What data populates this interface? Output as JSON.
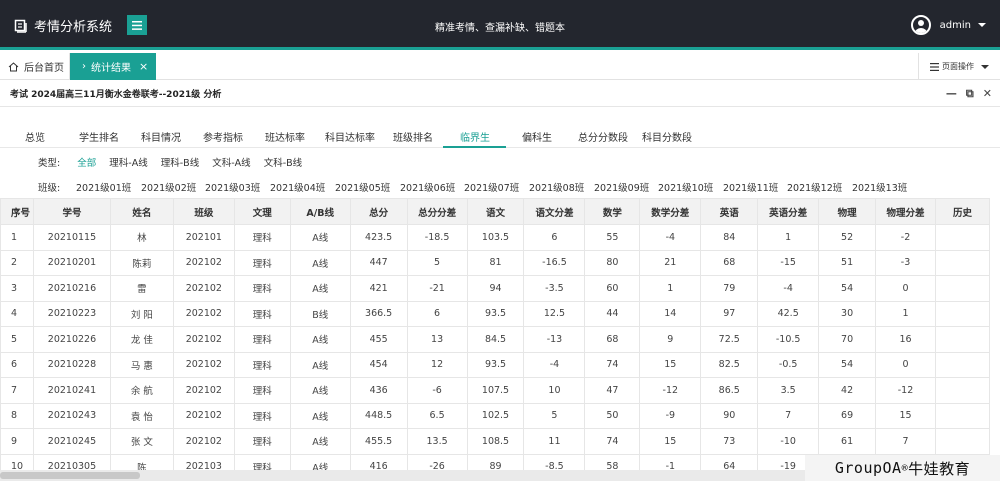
{
  "header": {
    "app_title": "考情分析系统",
    "slogan": "精准考情、查漏补缺、错题本",
    "username": "admin"
  },
  "tabs": {
    "home_label": "后台首页",
    "active_label": "统计结果",
    "page_ops_label": "页面操作"
  },
  "panel": {
    "title": "考试 2024届高三11月衡水金卷联考--2021级 分析"
  },
  "subtabs": [
    {
      "label": "总览"
    },
    {
      "label": "学生排名"
    },
    {
      "label": "科目情况"
    },
    {
      "label": "参考指标"
    },
    {
      "label": "班达标率"
    },
    {
      "label": "科目达标率"
    },
    {
      "label": "班级排名"
    },
    {
      "label": "临界生",
      "active": true
    },
    {
      "label": "偏科生"
    },
    {
      "label": "总分分数段"
    },
    {
      "label": "科目分数段"
    }
  ],
  "filters": {
    "type_label": "类型:",
    "type_options": [
      "全部",
      "理科-A线",
      "理科-B线",
      "文科-A线",
      "文科-B线"
    ],
    "type_selected": "全部",
    "class_label": "班级:",
    "class_options": [
      "2021级01班",
      "2021级02班",
      "2021级03班",
      "2021级04班",
      "2021级05班",
      "2021级06班",
      "2021级07班",
      "2021级08班",
      "2021级09班",
      "2021级10班",
      "2021级11班",
      "2021级12班",
      "2021级13班"
    ]
  },
  "table": {
    "columns": [
      "序号",
      "学号",
      "姓名",
      "班级",
      "文理",
      "A/B线",
      "总分",
      "总分分差",
      "语文",
      "语文分差",
      "数学",
      "数学分差",
      "英语",
      "英语分差",
      "物理",
      "物理分差",
      "历史"
    ],
    "rows": [
      [
        "1",
        "20210115",
        "林 ",
        "202101",
        "理科",
        "A线",
        "423.5",
        "-18.5",
        "103.5",
        "6",
        "55",
        "-4",
        "84",
        "1",
        "52",
        "-2",
        ""
      ],
      [
        "2",
        "20210201",
        "陈莉 ",
        "202102",
        "理科",
        "A线",
        "447",
        "5",
        "81",
        "-16.5",
        "80",
        "21",
        "68",
        "-15",
        "51",
        "-3",
        ""
      ],
      [
        "3",
        "20210216",
        "雷 ",
        "202102",
        "理科",
        "A线",
        "421",
        "-21",
        "94",
        "-3.5",
        "60",
        "1",
        "79",
        "-4",
        "54",
        "0",
        ""
      ],
      [
        "4",
        "20210223",
        "刘 阳",
        "202102",
        "理科",
        "B线",
        "366.5",
        "6",
        "93.5",
        "12.5",
        "44",
        "14",
        "97",
        "42.5",
        "30",
        "1",
        ""
      ],
      [
        "5",
        "20210226",
        "龙 佳",
        "202102",
        "理科",
        "A线",
        "455",
        "13",
        "84.5",
        "-13",
        "68",
        "9",
        "72.5",
        "-10.5",
        "70",
        "16",
        ""
      ],
      [
        "6",
        "20210228",
        "马 惠",
        "202102",
        "理科",
        "A线",
        "454",
        "12",
        "93.5",
        "-4",
        "74",
        "15",
        "82.5",
        "-0.5",
        "54",
        "0",
        ""
      ],
      [
        "7",
        "20210241",
        "余 航",
        "202102",
        "理科",
        "A线",
        "436",
        "-6",
        "107.5",
        "10",
        "47",
        "-12",
        "86.5",
        "3.5",
        "42",
        "-12",
        ""
      ],
      [
        "8",
        "20210243",
        "袁 怡",
        "202102",
        "理科",
        "A线",
        "448.5",
        "6.5",
        "102.5",
        "5",
        "50",
        "-9",
        "90",
        "7",
        "69",
        "15",
        ""
      ],
      [
        "9",
        "20210245",
        "张 文",
        "202102",
        "理科",
        "A线",
        "455.5",
        "13.5",
        "108.5",
        "11",
        "74",
        "15",
        "73",
        "-10",
        "61",
        "7",
        ""
      ],
      [
        "10",
        "20210305",
        "陈 ",
        "202103",
        "理科",
        "A线",
        "416",
        "-26",
        "89",
        "-8.5",
        "58",
        "-1",
        "64",
        "-19",
        "",
        ""
      ]
    ]
  },
  "watermark": {
    "text": "GroupOA",
    "registered": "®",
    "suffix": " 牛娃教育"
  },
  "colors": {
    "accent": "#1aa094",
    "topbar": "#23262e"
  }
}
